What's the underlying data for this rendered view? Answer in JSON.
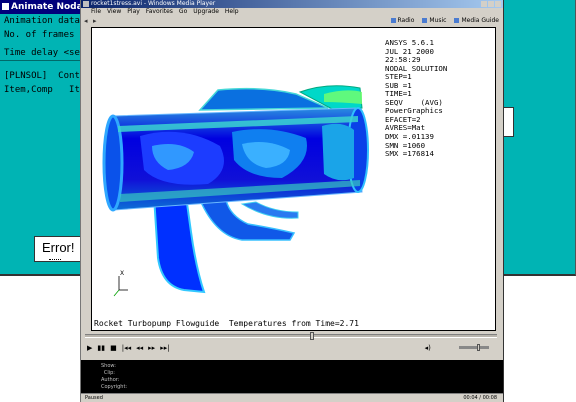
{
  "background_dialog": {
    "title": "Animate Nodal",
    "lines": [
      "Animation data",
      "No. of frames",
      "Time delay <se",
      "[PLNSOL]  Cont",
      "Item,Comp   It"
    ]
  },
  "error_box": {
    "text": "Error!"
  },
  "media_player": {
    "title": "rocket1stress.avi - Windows Media Player",
    "menu": [
      "File",
      "View",
      "Play",
      "Favorites",
      "Go",
      "Upgrade",
      "Help"
    ],
    "nav_back": "◂",
    "nav_forward": "▸",
    "nav_links": [
      "Radio",
      "Music",
      "Media Guide"
    ],
    "controls": [
      "▶",
      "▮▮",
      "■",
      "|◂◂",
      "◂◂",
      "▸▸",
      "▸▸|",
      "◂)"
    ],
    "info_labels": [
      "Show:",
      "Clip:",
      "Author:",
      "Copyright:"
    ],
    "status_left": "Paused",
    "status_right": "00:04 / 00:08"
  },
  "ansys_plot": {
    "caption": "Rocket Turbopump Flowguide  Temperatures from Time=2.71",
    "triad_label": "X",
    "info": [
      "ANSYS 5.6.1",
      "JUL 21 2000",
      "22:58:29",
      "NODAL SOLUTION",
      "STEP=1",
      "SUB =1",
      "TIME=1",
      "SEQV    (AVG)",
      "PowerGraphics",
      "EFACET=2",
      "AVRES=Mat",
      "DMX =.01139",
      "SMN =1060",
      "SMX =176814"
    ]
  },
  "colors": {
    "teal": "#00b4b4",
    "title_blue": "#00007b"
  }
}
